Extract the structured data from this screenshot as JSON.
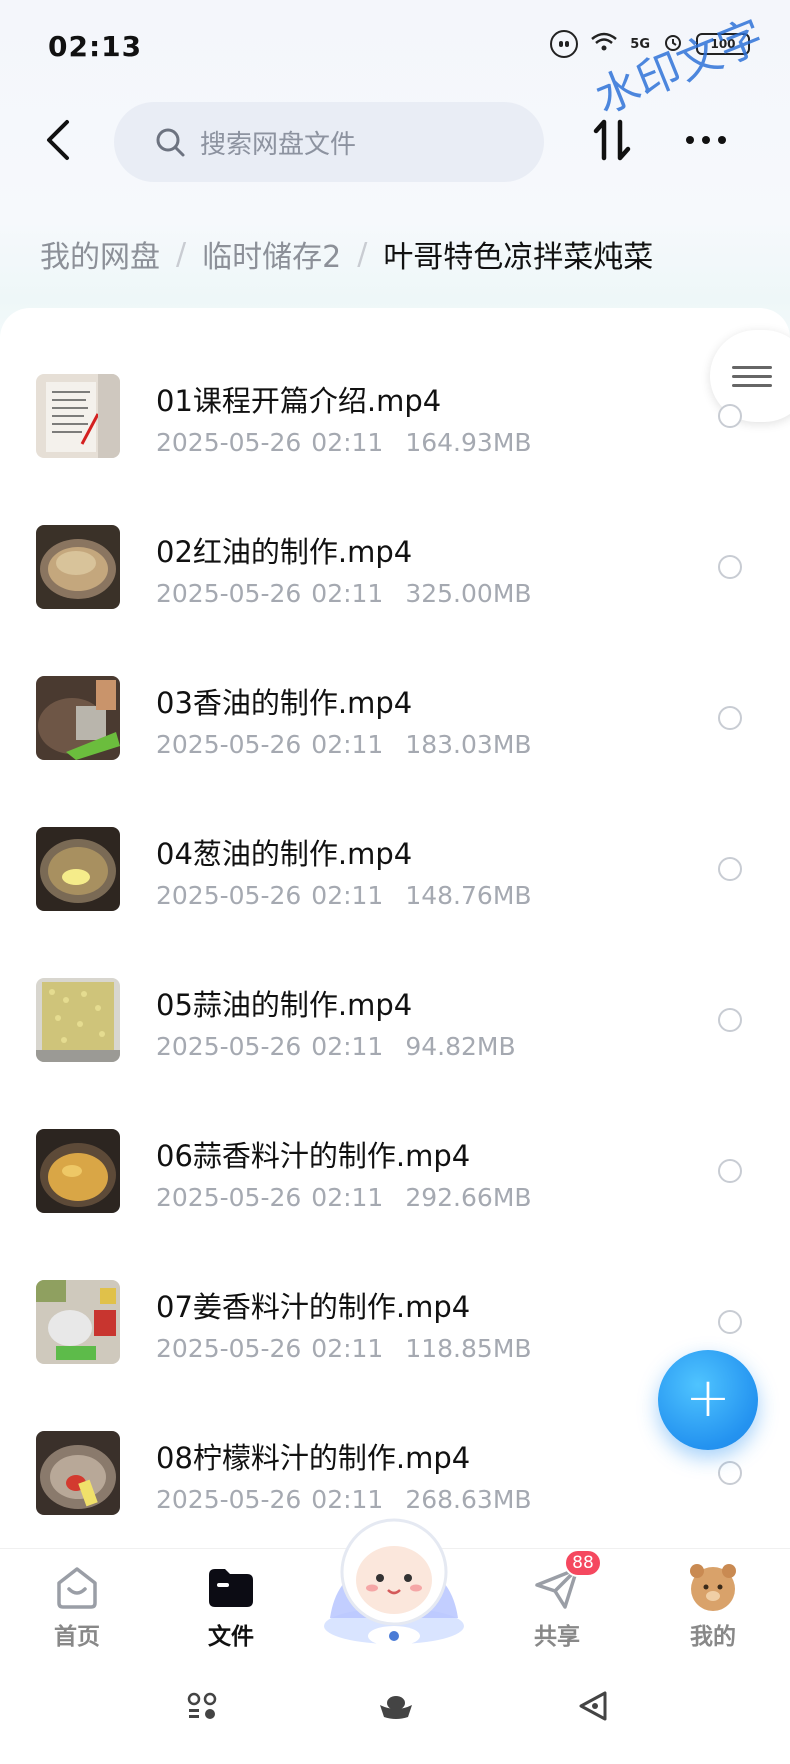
{
  "status_bar": {
    "time": "02:13",
    "network": "5G",
    "battery": "100",
    "watermark": "水印文字"
  },
  "header": {
    "search_placeholder": "搜索网盘文件",
    "icons": {
      "back": "back-arrow-icon",
      "search": "search-icon",
      "sort": "sort-icon",
      "more": "more-dots-icon"
    }
  },
  "breadcrumb": {
    "items": [
      "我的网盘",
      "临时储存2"
    ],
    "separator": "/",
    "current": "叶哥特色凉拌菜炖菜"
  },
  "files": [
    {
      "name": "01课程开篇介绍.mp4",
      "date": "2025-05-26",
      "time": "02:11",
      "size": "164.93MB"
    },
    {
      "name": "02红油的制作.mp4",
      "date": "2025-05-26",
      "time": "02:11",
      "size": "325.00MB"
    },
    {
      "name": "03香油的制作.mp4",
      "date": "2025-05-26",
      "time": "02:11",
      "size": "183.03MB"
    },
    {
      "name": "04葱油的制作.mp4",
      "date": "2025-05-26",
      "time": "02:11",
      "size": "148.76MB"
    },
    {
      "name": "05蒜油的制作.mp4",
      "date": "2025-05-26",
      "time": "02:11",
      "size": "94.82MB"
    },
    {
      "name": "06蒜香料汁的制作.mp4",
      "date": "2025-05-26",
      "time": "02:11",
      "size": "292.66MB"
    },
    {
      "name": "07姜香料汁的制作.mp4",
      "date": "2025-05-26",
      "time": "02:11",
      "size": "118.85MB"
    },
    {
      "name": "08柠檬料汁的制作.mp4",
      "date": "2025-05-26",
      "time": "02:11",
      "size": "268.63MB"
    }
  ],
  "fab": {
    "icon": "plus-icon"
  },
  "bottom_nav": {
    "items": [
      {
        "label": "首页",
        "icon": "home-icon",
        "active": false
      },
      {
        "label": "文件",
        "icon": "folder-icon",
        "active": true
      },
      {
        "label": "共享",
        "icon": "share-plane-icon",
        "active": false,
        "badge": "88"
      },
      {
        "label": "我的",
        "icon": "avatar-icon",
        "active": false
      }
    ]
  },
  "colors": {
    "accent": "#2493f0",
    "badge": "#f5485f",
    "meta_text": "#a5a9b1"
  }
}
